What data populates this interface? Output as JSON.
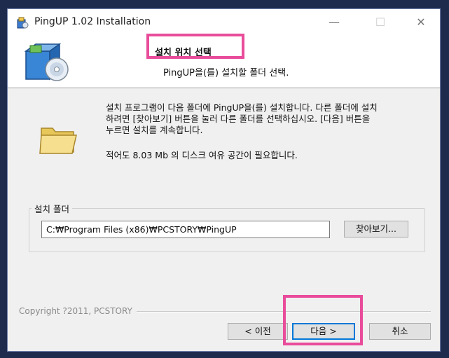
{
  "window": {
    "title": "PingUP 1.02 Installation",
    "min_glyph": "—",
    "max_glyph": "☐",
    "close_glyph": "✕"
  },
  "header": {
    "title": "설치 위치 선택",
    "subtitle": "PingUP을(를) 설치할 폴더 선택."
  },
  "body": {
    "description_lines": [
      "설치 프로그램이 다음 폴더에 PingUP을(를) 설치합니다. 다른 폴더에 설치",
      "하려면 [찾아보기] 버튼을 눌러 다른 폴더를 선택하십시오. [다음] 버튼을",
      "누르면 설치를 계속합니다."
    ],
    "space_required": "적어도 8.03 Mb 의 디스크 여유 공간이 필요합니다."
  },
  "folder_group": {
    "label": "설치 폴더",
    "path_value": "C:₩Program Files (x86)₩PCSTORY₩PingUP",
    "browse_label": "찾아보기..."
  },
  "footer": {
    "copyright": "Copyright ?2011, PCSTORY",
    "back_label": "< 이전",
    "next_label": "다음 >",
    "cancel_label": "취소"
  },
  "colors": {
    "highlight": "#e94c9a",
    "accent": "#0078d7"
  },
  "icons": {
    "app": "installer-box-icon",
    "header": "install-package-cd-icon",
    "folder": "folder-icon"
  }
}
